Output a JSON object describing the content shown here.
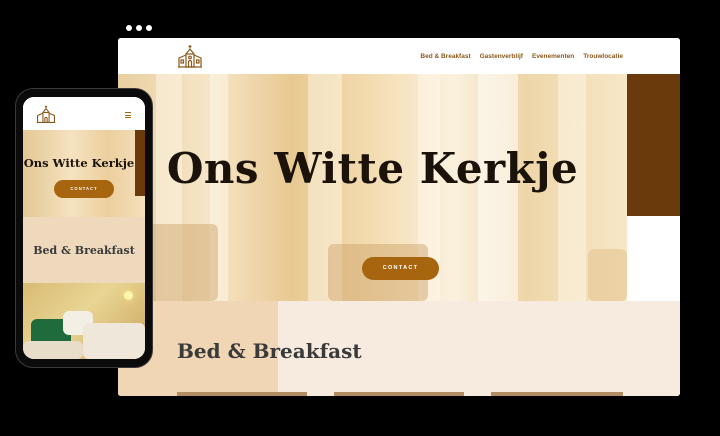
{
  "desktop": {
    "nav": {
      "logo_icon": "church-icon",
      "items": [
        "Bed & Breakfast",
        "Gastenverblijf",
        "Evenementen",
        "Trouwlocatie"
      ]
    },
    "hero": {
      "title": "Ons Witte Kerkje",
      "button_label": "CONTACT"
    },
    "section": {
      "title": "Bed & Breakfast"
    }
  },
  "mobile": {
    "nav": {
      "logo_icon": "church-icon",
      "menu_icon": "hamburger-menu-icon"
    },
    "hero": {
      "title": "Ons Witte Kerkje",
      "button_label": "CONTACT"
    },
    "section": {
      "title": "Bed & Breakfast"
    }
  },
  "colors": {
    "accent": "#a8650f",
    "brown_block": "#6b3a0c",
    "nav_link": "#8a5a1c",
    "section_bg": "#f7ebe0",
    "section_left_bg": "#f0d6b4"
  }
}
